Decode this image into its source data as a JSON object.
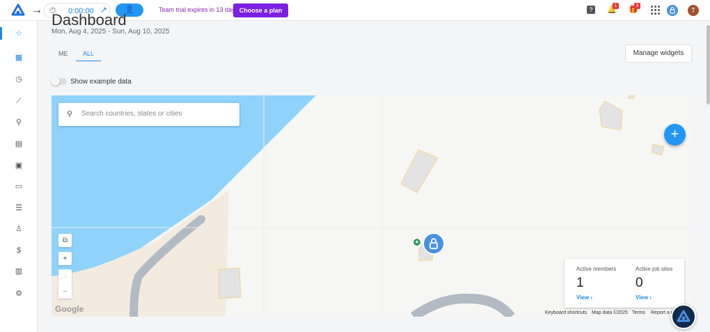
{
  "topbar": {
    "timer_value": "0:00:00",
    "trial_text": "Team trial expires in 13 days.",
    "plan_button": "Choose a plan",
    "notifications_count": "1",
    "gifts_count": "3",
    "user_initial": "T"
  },
  "page": {
    "title": "Dashboard",
    "date_range": "Mon, Aug 4, 2025 - Sun, Aug 10, 2025",
    "tabs": [
      {
        "label": "ME"
      },
      {
        "label": "ALL"
      }
    ],
    "manage_widgets": "Manage widgets",
    "toggle_label": "Show example data"
  },
  "map": {
    "search_placeholder": "Search countries, states or cities",
    "stats": {
      "active_members_label": "Active members",
      "active_members_value": "1",
      "active_sites_label": "Active job sites",
      "active_sites_value": "0",
      "view_label": "View"
    },
    "attribution": {
      "logo": "Google",
      "shortcuts": "Keyboard shortcuts",
      "map_data": "Map data ©2025",
      "terms": "Terms",
      "report": "Report a map error"
    }
  },
  "colors": {
    "accent": "#2196f3",
    "plan": "#7b1fe0",
    "water": "#8fd3fb",
    "land": "#f3ebe0"
  }
}
